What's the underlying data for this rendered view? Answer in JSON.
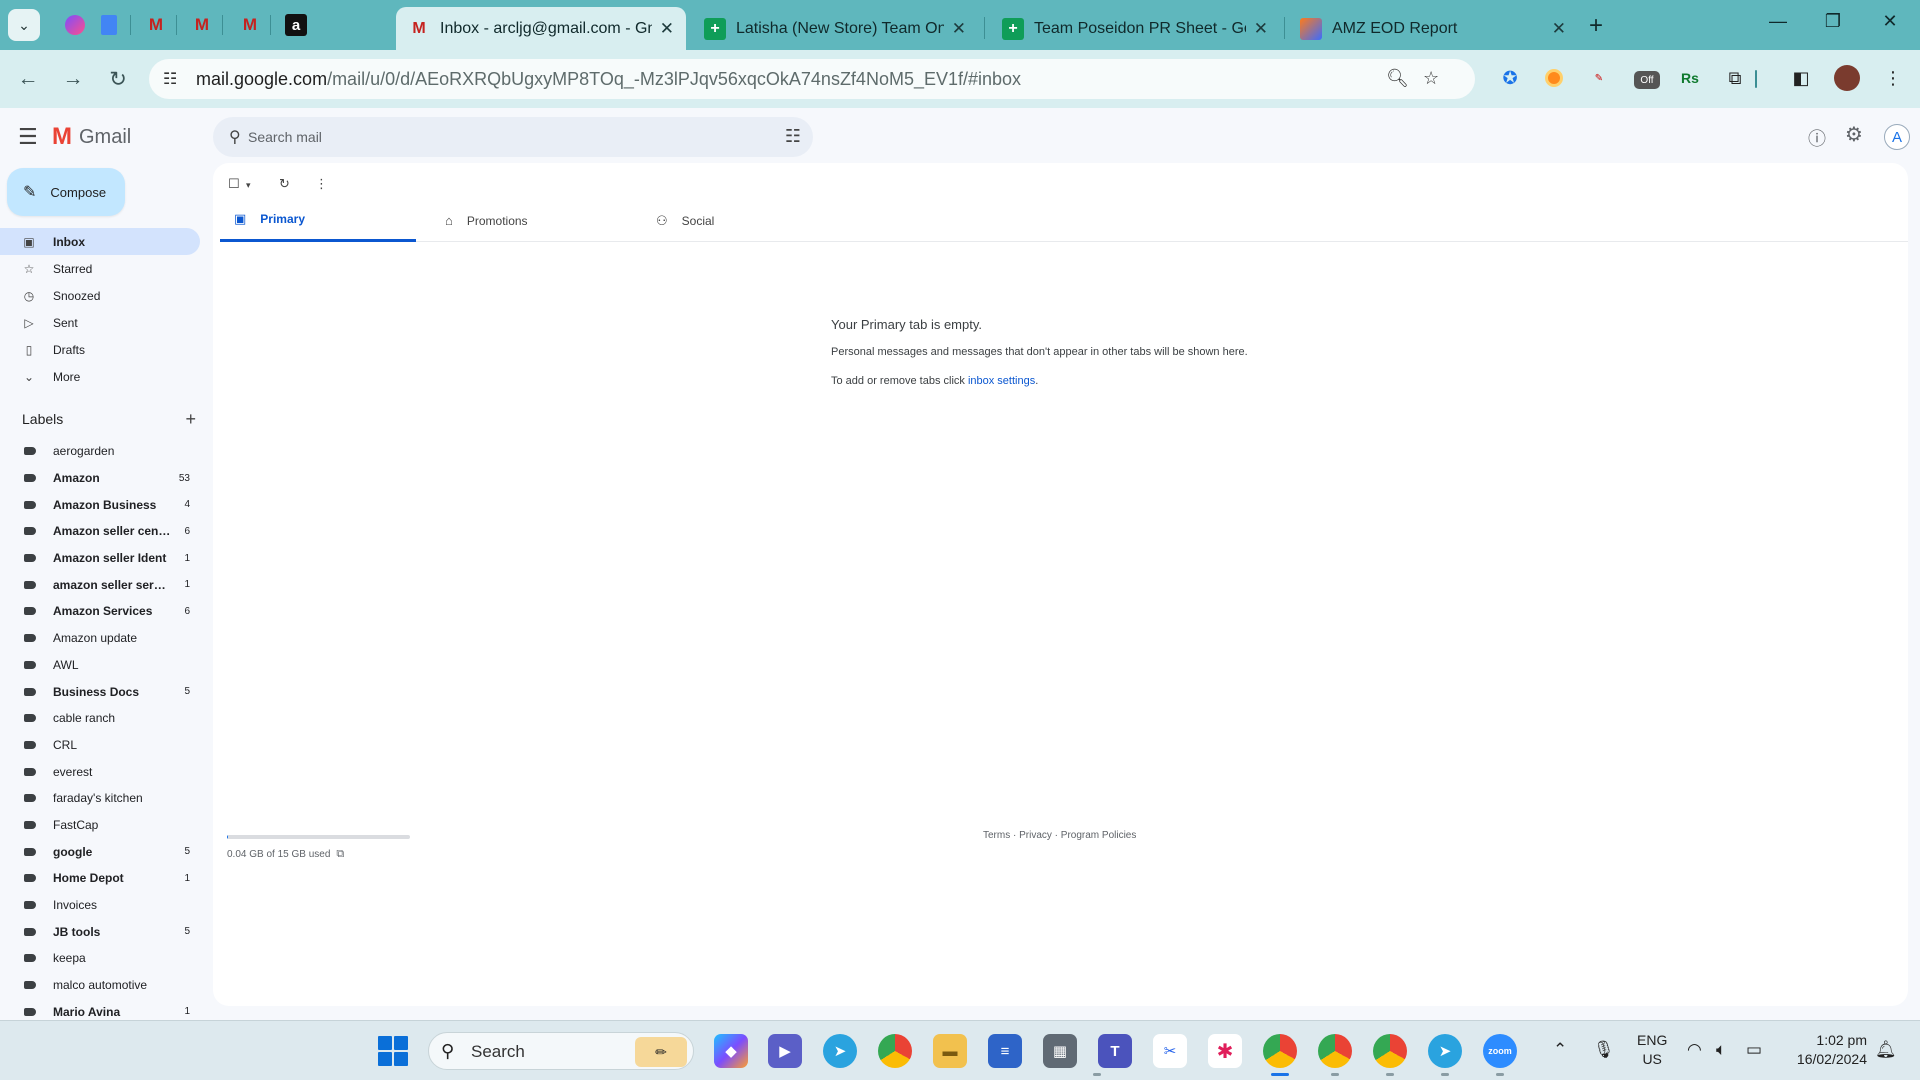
{
  "browser": {
    "tabs": [
      {
        "title": "Inbox - arcljg@gmail.com - Gm",
        "icon": "gmail-icon"
      },
      {
        "title": "Latisha (New Store) Team Only",
        "icon": "sheets-icon"
      },
      {
        "title": "Team Poseidon PR Sheet - Goo",
        "icon": "sheets-icon"
      },
      {
        "title": "AMZ EOD Report",
        "icon": "report-icon"
      }
    ],
    "url_host": "mail.google.com",
    "url_path": "/mail/u/0/d/AEoRXRQbUgxyMP8TOq_-Mz3lPJqv56xqcOkA74nsZf4NoM5_EV1f/#inbox",
    "ext_badge": "Off",
    "ext_rs": "Rs"
  },
  "gmail": {
    "brand": "Gmail",
    "search_placeholder": "Search mail",
    "avatar_letter": "A",
    "compose_label": "Compose",
    "nav": [
      {
        "label": "Inbox",
        "icon": "inbox-icon"
      },
      {
        "label": "Starred",
        "icon": "star-icon"
      },
      {
        "label": "Snoozed",
        "icon": "clock-icon"
      },
      {
        "label": "Sent",
        "icon": "send-icon"
      },
      {
        "label": "Drafts",
        "icon": "draft-icon"
      },
      {
        "label": "More",
        "icon": "chevron-down-icon"
      }
    ],
    "labels_heading": "Labels",
    "labels": [
      {
        "name": "aerogarden",
        "count": "",
        "bold": false
      },
      {
        "name": "Amazon",
        "count": "53",
        "bold": true
      },
      {
        "name": "Amazon Business",
        "count": "4",
        "bold": true
      },
      {
        "name": "Amazon seller cent...",
        "count": "6",
        "bold": true
      },
      {
        "name": "Amazon seller Ident",
        "count": "1",
        "bold": true
      },
      {
        "name": "amazon seller servi...",
        "count": "1",
        "bold": true
      },
      {
        "name": "Amazon Services",
        "count": "6",
        "bold": true
      },
      {
        "name": "Amazon update",
        "count": "",
        "bold": false
      },
      {
        "name": "AWL",
        "count": "",
        "bold": false
      },
      {
        "name": "Business Docs",
        "count": "5",
        "bold": true
      },
      {
        "name": "cable ranch",
        "count": "",
        "bold": false
      },
      {
        "name": "CRL",
        "count": "",
        "bold": false
      },
      {
        "name": "everest",
        "count": "",
        "bold": false
      },
      {
        "name": "faraday's kitchen",
        "count": "",
        "bold": false
      },
      {
        "name": "FastCap",
        "count": "",
        "bold": false
      },
      {
        "name": "google",
        "count": "5",
        "bold": true
      },
      {
        "name": "Home Depot",
        "count": "1",
        "bold": true
      },
      {
        "name": "Invoices",
        "count": "",
        "bold": false
      },
      {
        "name": "JB tools",
        "count": "5",
        "bold": true
      },
      {
        "name": "keepa",
        "count": "",
        "bold": false
      },
      {
        "name": "malco automotive",
        "count": "",
        "bold": false
      },
      {
        "name": "Mario Avina",
        "count": "1",
        "bold": true
      }
    ],
    "tabs": [
      {
        "label": "Primary",
        "icon": "inbox-tab-icon"
      },
      {
        "label": "Promotions",
        "icon": "tag-icon"
      },
      {
        "label": "Social",
        "icon": "people-icon"
      }
    ],
    "empty": {
      "title": "Your Primary tab is empty.",
      "subtitle": "Personal messages and messages that don't appear in other tabs will be shown here.",
      "settings_prefix": "To add or remove tabs click ",
      "settings_link": "inbox settings",
      "settings_suffix": "."
    },
    "storage": {
      "text": "0.04 GB of 15 GB used",
      "used_fraction": 0.003
    },
    "footer": "Terms · Privacy · Program Policies"
  },
  "taskbar": {
    "search_label": "Search",
    "lang_top": "ENG",
    "lang_bottom": "US",
    "time": "1:02 pm",
    "date": "16/02/2024"
  }
}
